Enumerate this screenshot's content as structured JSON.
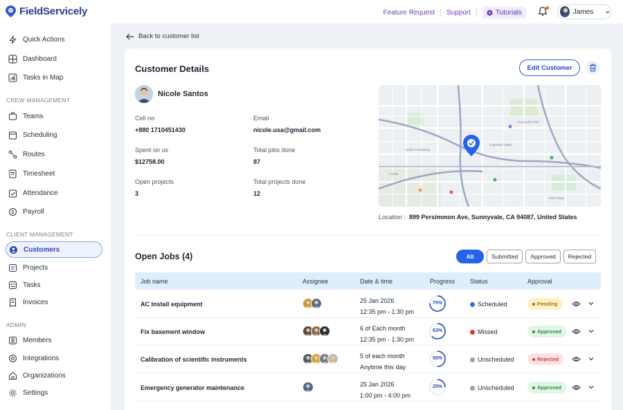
{
  "app": {
    "name": "FieldServicely"
  },
  "topbar": {
    "feature_request": "Feature Request",
    "support": "Support",
    "tutorials": "Tutorials",
    "user_name": "James"
  },
  "sidebar": {
    "top": [
      {
        "label": "Quick Actions",
        "icon": "lightning-icon"
      },
      {
        "label": "Dashboard",
        "icon": "dashboard-icon"
      },
      {
        "label": "Tasks in Map",
        "icon": "map-icon"
      }
    ],
    "crew_title": "CREW MANAGEMENT",
    "crew": [
      {
        "label": "Teams",
        "icon": "team-icon"
      },
      {
        "label": "Scheduling",
        "icon": "calendar-icon"
      },
      {
        "label": "Routes",
        "icon": "route-icon"
      },
      {
        "label": "Timesheet",
        "icon": "timesheet-icon"
      },
      {
        "label": "Attendance",
        "icon": "attendance-icon"
      },
      {
        "label": "Payroll",
        "icon": "payroll-icon"
      }
    ],
    "client_title": "CLIENT MANAGEMENT",
    "client": [
      {
        "label": "Customers",
        "icon": "customers-icon",
        "active": true
      },
      {
        "label": "Projects",
        "icon": "projects-icon"
      },
      {
        "label": "Tasks",
        "icon": "tasks-icon"
      },
      {
        "label": "Invoices",
        "icon": "invoice-icon"
      }
    ],
    "admin_title": "ADMIN",
    "admin": [
      {
        "label": "Members",
        "icon": "members-icon"
      },
      {
        "label": "Integrations",
        "icon": "integrations-icon"
      },
      {
        "label": "Organizations",
        "icon": "organizations-icon"
      },
      {
        "label": "Settings",
        "icon": "settings-icon"
      }
    ]
  },
  "main": {
    "back_label": "Back to customer list",
    "title": "Customer Details",
    "edit_label": "Edit Customer",
    "customer": {
      "name": "Nicole Santos",
      "cell_label": "Cell no",
      "cell": "+880 1710451430",
      "email_label": "Email",
      "email": "nicole.usa@gmail.com",
      "spent_label": "Spent on us",
      "spent": "$12758.00",
      "jobs_done_label": "Total jobs done",
      "jobs_done": "87",
      "open_projects_label": "Open projects",
      "open_projects": "3",
      "projects_done_label": "Total projects done",
      "projects_done": "12"
    },
    "location_label": "Location :",
    "location": "899 Persimmon Ave, Sunnyvale, CA 94087, United States"
  },
  "jobs": {
    "title": "Open Jobs (4)",
    "filters": [
      "All",
      "Submitted",
      "Approved",
      "Rejected"
    ],
    "columns": [
      "Job name",
      "Assignee",
      "Date & time",
      "Progress",
      "Status",
      "Approval"
    ],
    "rows": [
      {
        "name": "AC Install equipment",
        "date1": "25 Jan 2026",
        "date2": "12:35 pm - 1:30 pm",
        "progress": 75,
        "progress_label": "75%",
        "status": "Scheduled",
        "status_color": "#2f6fe0",
        "approval": "Pending",
        "approval_bg": "#fdf1c9",
        "approval_fg": "#b07a00",
        "faces": [
          "#c89a3a",
          "#5d6b80"
        ]
      },
      {
        "name": "Fix basement window",
        "date1": "6 of Each month",
        "date2": "12:35 pm - 1:30 pm",
        "progress": 63,
        "progress_label": "63%",
        "status": "Missed",
        "status_color": "#e03131",
        "approval": "Approved",
        "approval_bg": "#e2f6e6",
        "approval_fg": "#2b8a3e",
        "faces": [
          "#5a4a42",
          "#8a6a55",
          "#2e2e2e"
        ]
      },
      {
        "name": "Calibration of scientific instruments",
        "date1": "5 of each month",
        "date2": "Anytime this day",
        "progress": 50,
        "progress_label": "50%",
        "status": "Unscheduled",
        "status_color": "#9a9ea8",
        "approval": "Rejected",
        "approval_bg": "#fde3e3",
        "approval_fg": "#d23c3c",
        "faces": [
          "#4a5a70",
          "#d4a53a",
          "#6c7a8a",
          "#c8b8a8"
        ]
      },
      {
        "name": "Emergency generator maintenance",
        "date1": "25 Jan 2026",
        "date2": "1:00 pm - 4:00 pm",
        "progress": 25,
        "progress_label": "25%",
        "status": "Unscheduled",
        "status_color": "#9a9ea8",
        "approval": "Approved",
        "approval_bg": "#e2f6e6",
        "approval_fg": "#2b8a3e",
        "faces": [
          "#4a6a90"
        ]
      }
    ]
  }
}
